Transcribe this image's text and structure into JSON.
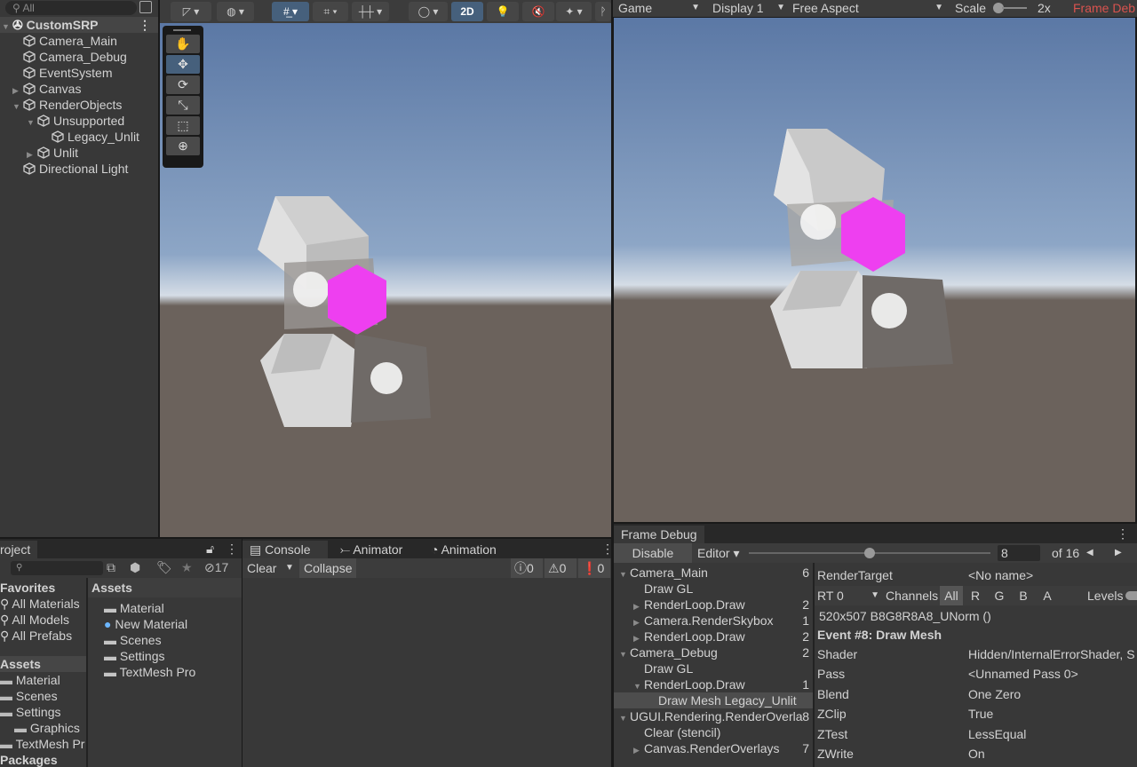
{
  "hierarchy": {
    "search_placeholder": "All",
    "scene": "CustomSRP",
    "items": [
      {
        "label": "Camera_Main",
        "depth": 1,
        "arrow": ""
      },
      {
        "label": "Camera_Debug",
        "depth": 1,
        "arrow": ""
      },
      {
        "label": "EventSystem",
        "depth": 1,
        "arrow": ""
      },
      {
        "label": "Canvas",
        "depth": 1,
        "arrow": "▶"
      },
      {
        "label": "RenderObjects",
        "depth": 1,
        "arrow": "▼"
      },
      {
        "label": "Unsupported",
        "depth": 2,
        "arrow": "▼"
      },
      {
        "label": "Legacy_Unlit",
        "depth": 3,
        "arrow": ""
      },
      {
        "label": "Unlit",
        "depth": 2,
        "arrow": "▶"
      },
      {
        "label": "Directional Light",
        "depth": 1,
        "arrow": ""
      }
    ]
  },
  "scene_toolbar": {
    "mode_2d": "2D"
  },
  "game": {
    "tab": "Game",
    "display": "Display 1",
    "aspect": "Free Aspect",
    "scale_label": "Scale",
    "scale_value": "2x",
    "frame_debug_tab": "Frame Deb"
  },
  "colors": {
    "magenta": "#ee3ff0",
    "sky_top": "#5b78a5",
    "ground": "#6b625c",
    "accent_red": "#d9534f"
  },
  "project": {
    "tab": "roject",
    "hidden_count": "17",
    "favorites_header": "Favorites",
    "favorites": [
      "All Materials",
      "All Models",
      "All Prefabs"
    ],
    "tree": [
      {
        "label": "Assets",
        "selected": true,
        "indent": 0
      },
      {
        "label": "Material",
        "indent": 1
      },
      {
        "label": "Scenes",
        "indent": 1
      },
      {
        "label": "Settings",
        "indent": 1
      },
      {
        "label": "Graphics",
        "indent": 2
      },
      {
        "label": "TextMesh Pr",
        "indent": 1
      },
      {
        "label": "Packages",
        "indent": 0
      }
    ],
    "assets_header": "Assets",
    "assets": [
      {
        "label": "Material",
        "icon": "folder"
      },
      {
        "label": "New Material",
        "icon": "material"
      },
      {
        "label": "Scenes",
        "icon": "folder"
      },
      {
        "label": "Settings",
        "icon": "folder"
      },
      {
        "label": "TextMesh Pro",
        "icon": "folder"
      }
    ]
  },
  "console": {
    "tabs": [
      "Console",
      "Animator",
      "Animation"
    ],
    "clear": "Clear",
    "collapse": "Collapse",
    "info_count": "0",
    "warn_count": "0",
    "error_count": "0"
  },
  "frame_debug": {
    "tab": "Frame Debug",
    "disable": "Disable",
    "editor": "Editor",
    "event_value": "8",
    "of_total": "of 16",
    "slider_fraction": 0.5,
    "tree": [
      {
        "label": "Camera_Main",
        "count": "6",
        "arrow": "▼",
        "indent": 0
      },
      {
        "label": "Draw GL",
        "count": "",
        "arrow": "",
        "indent": 1
      },
      {
        "label": "RenderLoop.Draw",
        "count": "2",
        "arrow": "▶",
        "indent": 1
      },
      {
        "label": "Camera.RenderSkybox",
        "count": "1",
        "arrow": "▶",
        "indent": 1
      },
      {
        "label": "RenderLoop.Draw",
        "count": "2",
        "arrow": "▶",
        "indent": 1
      },
      {
        "label": "Camera_Debug",
        "count": "2",
        "arrow": "▼",
        "indent": 0
      },
      {
        "label": "Draw GL",
        "count": "",
        "arrow": "",
        "indent": 1
      },
      {
        "label": "RenderLoop.Draw",
        "count": "1",
        "arrow": "▼",
        "indent": 1
      },
      {
        "label": "Draw Mesh Legacy_Unlit",
        "count": "",
        "arrow": "",
        "indent": 2,
        "selected": true
      },
      {
        "label": "UGUI.Rendering.RenderOverla",
        "count": "8",
        "arrow": "▼",
        "indent": 0
      },
      {
        "label": "Clear (stencil)",
        "count": "",
        "arrow": "",
        "indent": 1
      },
      {
        "label": "Canvas.RenderOverlays",
        "count": "7",
        "arrow": "▶",
        "indent": 1
      }
    ],
    "render_target_label": "RenderTarget",
    "render_target_value": "<No name>",
    "rt": "RT 0",
    "channels": "Channels",
    "channel_opts": [
      "All",
      "R",
      "G",
      "B",
      "A"
    ],
    "levels": "Levels",
    "format": "520x507 B8G8R8A8_UNorm ()",
    "event": "Event #8: Draw Mesh",
    "props": [
      {
        "k": "Shader",
        "v": "Hidden/InternalErrorShader, S"
      },
      {
        "k": "Pass",
        "v": "<Unnamed Pass 0>"
      },
      {
        "k": "Blend",
        "v": "One Zero"
      },
      {
        "k": "ZClip",
        "v": "True"
      },
      {
        "k": "ZTest",
        "v": "LessEqual"
      },
      {
        "k": "ZWrite",
        "v": "On"
      }
    ]
  }
}
